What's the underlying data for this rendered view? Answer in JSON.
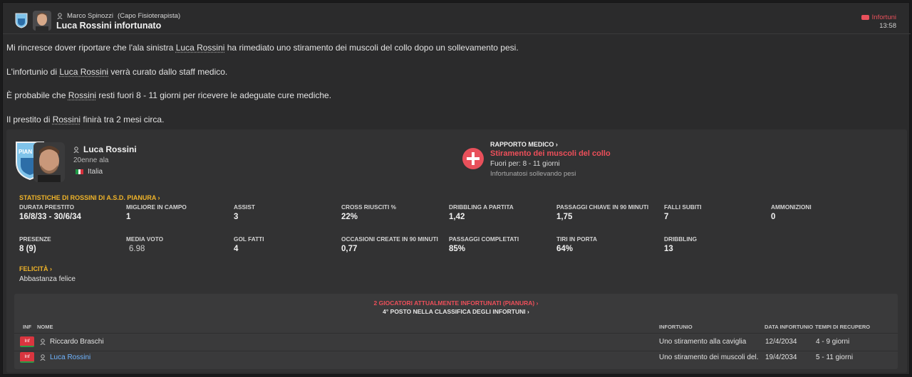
{
  "header": {
    "sender_name": "Marco Spinozzi",
    "sender_role": "(Capo Fisioterapista)",
    "subject": "Luca Rossini infortunato",
    "tag_label": "Infortuni",
    "time": "13:58"
  },
  "body": {
    "p1_a": "Mi rincresce dover riportare che l'ala sinistra ",
    "p1_name": "Luca Rossini",
    "p1_b": " ha rimediato uno stiramento dei muscoli del collo dopo un sollevamento pesi.",
    "p2_a": "L'infortunio di ",
    "p2_name": "Luca Rossini",
    "p2_b": " verrà curato dallo staff medico.",
    "p3_a": "È probabile che ",
    "p3_name": "Rossini",
    "p3_b": " resti fuori 8 - 11 giorni per ricevere le adeguate cure mediche.",
    "p4_a": "Il prestito di ",
    "p4_name": "Rossini",
    "p4_b": " finirà tra 2 mesi circa."
  },
  "player": {
    "badge_text": "PIAN",
    "name": "Luca Rossini",
    "age_position": "20enne ala",
    "nationality": "Italia"
  },
  "medical": {
    "title": "RAPPORTO MEDICO ›",
    "injury": "Stiramento dei muscoli del collo",
    "out_for": "Fuori per: 8 - 11 giorni",
    "cause": "Infortunatosi sollevando pesi"
  },
  "stats": {
    "title": "STATISTICHE DI ROSSINI DI A.S.D. PIANURA ›",
    "items": [
      {
        "label": "DURATA PRESTITO",
        "value": "16/8/33 - 30/6/34"
      },
      {
        "label": "MIGLIORE IN CAMPO",
        "value": "1"
      },
      {
        "label": "ASSIST",
        "value": "3"
      },
      {
        "label": "CROSS RIUSCITI %",
        "value": "22%"
      },
      {
        "label": "DRIBBLING A PARTITA",
        "value": "1,42"
      },
      {
        "label": "PASSAGGI CHIAVE IN 90 MINUTI",
        "value": "1,75"
      },
      {
        "label": "FALLI SUBITI",
        "value": "7"
      },
      {
        "label": "AMMONIZIONI",
        "value": "0"
      },
      {
        "label": "PRESENZE",
        "value": "8 (9)"
      },
      {
        "label": "MEDIA VOTO",
        "value": "6.98"
      },
      {
        "label": "GOL FATTI",
        "value": "4"
      },
      {
        "label": "OCCASIONI CREATE IN 90 MINUTI",
        "value": "0,77"
      },
      {
        "label": "PASSAGGI COMPLETATI",
        "value": "85%"
      },
      {
        "label": "TIRI IN PORTA",
        "value": "64%"
      },
      {
        "label": "DRIBBLING",
        "value": "13"
      }
    ]
  },
  "happiness": {
    "title": "FELICITÀ ›",
    "value": "Abbastanza felice"
  },
  "injuries": {
    "heading": "2 GIOCATORI ATTUALMENTE INFORTUNATI (PIANURA) ›",
    "subheading": "4° POSTO NELLA CLASSIFICA DEGLI INFORTUNI ›",
    "columns": {
      "inf": "INF",
      "name": "NOME",
      "injury": "INFORTUNIO",
      "date": "DATA INFORTUNIO",
      "recovery": "TEMPI DI RECUPERO"
    },
    "badge_label": "Inf",
    "rows": [
      {
        "name": "Riccardo Braschi",
        "injury": "Uno stiramento alla caviglia",
        "date": "12/4/2034",
        "recovery": "4 - 9 giorni"
      },
      {
        "name": "Luca Rossini",
        "injury": "Uno stiramento dei muscoli del...",
        "date": "19/4/2034",
        "recovery": "5 - 11 giorni"
      }
    ]
  },
  "colors": {
    "accent_red": "#e8505b",
    "accent_yellow": "#f0b429",
    "link_blue": "#6fb4ff"
  }
}
